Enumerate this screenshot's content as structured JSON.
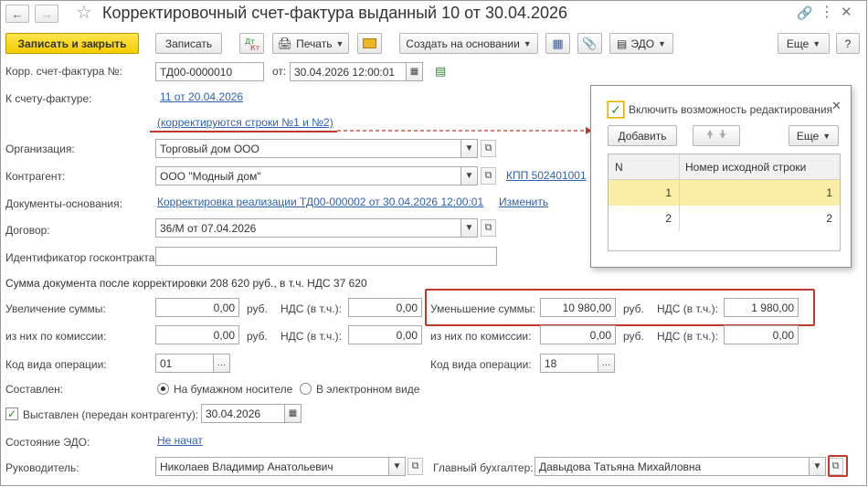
{
  "window": {
    "title": "Корректировочный счет-фактура выданный 10 от 30.04.2026"
  },
  "toolbar": {
    "save_close": "Записать и закрыть",
    "save": "Записать",
    "print": "Печать",
    "create_based": "Создать на основании",
    "edo": "ЭДО",
    "more": "Еще",
    "help": "?"
  },
  "form": {
    "corr_invoice_label": "Корр. счет-фактура №:",
    "corr_invoice_number": "ТД00-0000010",
    "from_label": "от:",
    "corr_invoice_date": "30.04.2026 12:00:01",
    "to_invoice_label": "К счету-фактуре:",
    "to_invoice_link": "11 от 20.04.2026",
    "corrected_rows_link": "(корректируются строки №1 и №2)",
    "org_label": "Организация:",
    "org_value": "Торговый дом ООО",
    "contractor_label": "Контрагент:",
    "contractor_value": "ООО \"Модный дом\"",
    "kpp_link": "КПП 502401001",
    "base_docs_label": "Документы-основания:",
    "base_docs_link": "Корректировка реализации ТД00-000002 от 30.04.2026 12:00:01",
    "change_link": "Изменить",
    "contract_label": "Договор:",
    "contract_value": "36/М от 07.04.2026",
    "gov_contract_label": "Идентификатор госконтракта:",
    "gov_contract_value": "",
    "sum_after_text": "Сумма документа после корректировки 208 620 руб., в т.ч. НДС 37 620",
    "increase_label": "Увеличение суммы:",
    "increase_value": "0,00",
    "rub": "руб.",
    "vat_incl_label": "НДС (в т.ч.):",
    "increase_vat_value": "0,00",
    "decrease_label": "Уменьшение суммы:",
    "decrease_value": "10 980,00",
    "decrease_vat_value": "1 980,00",
    "commission_label": "из них по комиссии:",
    "commission_value": "0,00",
    "commission_vat_value": "0,00",
    "commission2_label": "из них по комиссии:",
    "commission2_value": "0,00",
    "commission2_vat_value": "0,00",
    "op_code_label": "Код вида операции:",
    "op_code_value": "01",
    "op_code2_label": "Код вида операции:",
    "op_code2_value": "18",
    "composed_label": "Составлен:",
    "paper_label": "На бумажном носителе",
    "electronic_label": "В электронном виде",
    "issued_label": "Выставлен (передан контрагенту):",
    "issued_date": "30.04.2026",
    "edo_state_label": "Состояние ЭДО:",
    "edo_state_link": "Не начат",
    "head_label": "Руководитель:",
    "head_value": "Николаев Владимир Анатольевич",
    "chief_acc_label": "Главный бухгалтер:",
    "chief_acc_value": "Давыдова Татьяна Михайловна"
  },
  "popup": {
    "enable_edit_label": "Включить возможность редактирования",
    "add_button": "Добавить",
    "more_button": "Еще",
    "columns": [
      "N",
      "Номер исходной строки"
    ],
    "rows": [
      {
        "n": "1",
        "src": "1"
      },
      {
        "n": "2",
        "src": "2"
      }
    ]
  },
  "colors": {
    "accent_yellow": "#f5cc00",
    "link_blue": "#2f62ac",
    "highlight_red": "#c0392b",
    "selected_row": "#fbeda4"
  }
}
